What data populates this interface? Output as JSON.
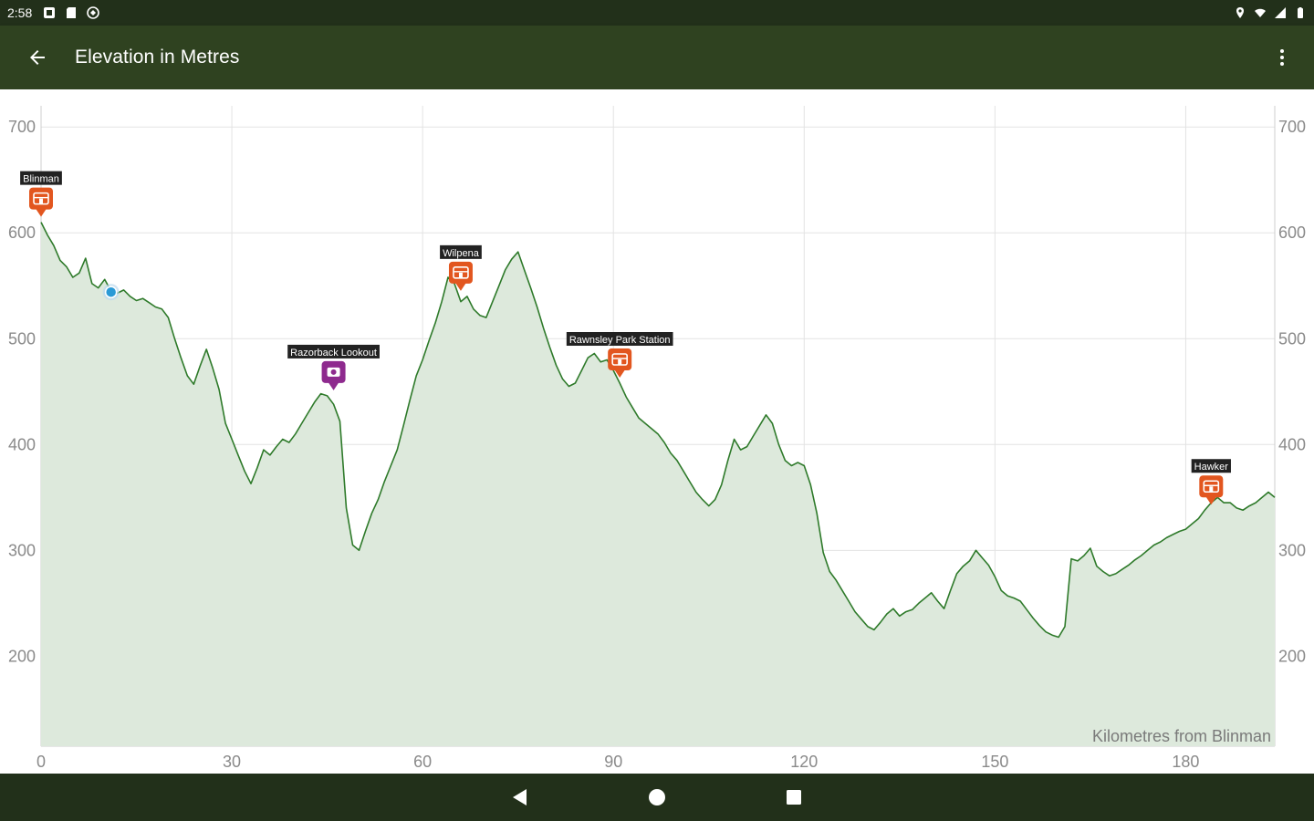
{
  "status_bar": {
    "time": "2:58",
    "left_icons": [
      "notification-icon",
      "sd-card-icon",
      "sync-icon"
    ],
    "right_icons": [
      "location-icon",
      "wifi-icon",
      "signal-icon",
      "battery-icon"
    ]
  },
  "app_bar": {
    "title": "Elevation in Metres",
    "back_icon": "arrow-back-icon",
    "menu_icon": "more-vert-icon"
  },
  "nav_bar": {
    "icons": [
      "nav-back-icon",
      "nav-home-icon",
      "nav-recents-icon"
    ]
  },
  "colors": {
    "status_bar": "#22301a",
    "app_bar": "#2f4220",
    "line": "#2e7a2a",
    "fill": "#dde9dc",
    "accommodation_marker": "#e2561f",
    "lookout_marker": "#8e2a8e",
    "current_position": "#2a9ad6",
    "grid": "#e3e3e3"
  },
  "chart_data": {
    "type": "area",
    "title": "",
    "xlabel": "Kilometres from Blinman",
    "ylabel": "",
    "xlim": [
      0,
      194
    ],
    "ylim": [
      115,
      720
    ],
    "xticks": [
      0,
      30,
      60,
      90,
      120,
      150,
      180
    ],
    "yticks": [
      200,
      300,
      400,
      500,
      600,
      700
    ],
    "grid": true,
    "y_axis_sides": [
      "left",
      "right"
    ],
    "series": [
      {
        "x": [
          0,
          1,
          2,
          3,
          4,
          5,
          6,
          7,
          8,
          9,
          10,
          11,
          12,
          13,
          14,
          15,
          16,
          17,
          18,
          19,
          20,
          21,
          22,
          23,
          24,
          25,
          26,
          27,
          28,
          29,
          30,
          31,
          32,
          33,
          34,
          35,
          36,
          37,
          38,
          39,
          40,
          41,
          42,
          43,
          44,
          45,
          46,
          47,
          48,
          49,
          50,
          51,
          52,
          53,
          54,
          55,
          56,
          57,
          58,
          59,
          60,
          61,
          62,
          63,
          64,
          65,
          66,
          67,
          68,
          69,
          70,
          71,
          72,
          73,
          74,
          75,
          76,
          77,
          78,
          79,
          80,
          81,
          82,
          83,
          84,
          85,
          86,
          87,
          88,
          89,
          90,
          91,
          92,
          93,
          94,
          95,
          96,
          97,
          98,
          99,
          100,
          101,
          102,
          103,
          104,
          105,
          106,
          107,
          108,
          109,
          110,
          111,
          112,
          113,
          114,
          115,
          116,
          117,
          118,
          119,
          120,
          121,
          122,
          123,
          124,
          125,
          126,
          127,
          128,
          129,
          130,
          131,
          132,
          133,
          134,
          135,
          136,
          137,
          138,
          139,
          140,
          141,
          142,
          143,
          144,
          145,
          146,
          147,
          148,
          149,
          150,
          151,
          152,
          153,
          154,
          155,
          156,
          157,
          158,
          159,
          160,
          161,
          162,
          163,
          164,
          165,
          166,
          167,
          168,
          169,
          170,
          171,
          172,
          173,
          174,
          175,
          176,
          177,
          178,
          179,
          180,
          181,
          182,
          183,
          184,
          185,
          186,
          187,
          188,
          189,
          190,
          191,
          192,
          193,
          194
        ],
        "y": [
          610,
          598,
          588,
          574,
          568,
          558,
          562,
          576,
          552,
          548,
          556,
          545,
          543,
          546,
          540,
          536,
          538,
          534,
          530,
          528,
          520,
          500,
          482,
          465,
          457,
          474,
          490,
          472,
          452,
          420,
          405,
          390,
          375,
          363,
          378,
          395,
          390,
          398,
          405,
          402,
          410,
          420,
          430,
          440,
          448,
          446,
          438,
          422,
          340,
          305,
          300,
          318,
          335,
          348,
          365,
          380,
          395,
          418,
          442,
          465,
          480,
          498,
          515,
          535,
          558,
          552,
          535,
          540,
          528,
          522,
          520,
          535,
          550,
          565,
          575,
          582,
          565,
          548,
          530,
          510,
          492,
          475,
          462,
          455,
          458,
          470,
          482,
          486,
          478,
          480,
          470,
          458,
          445,
          435,
          425,
          420,
          415,
          410,
          402,
          392,
          385,
          375,
          365,
          355,
          348,
          342,
          348,
          362,
          385,
          405,
          395,
          398,
          408,
          418,
          428,
          420,
          400,
          385,
          380,
          383,
          380,
          362,
          335,
          298,
          280,
          272,
          262,
          252,
          242,
          235,
          228,
          225,
          232,
          240,
          245,
          238,
          242,
          244,
          250,
          255,
          260,
          252,
          245,
          262,
          278,
          285,
          290,
          300,
          293,
          286,
          275,
          262,
          257,
          255,
          252,
          244,
          236,
          229,
          223,
          220,
          218,
          228,
          292,
          290,
          295,
          302,
          285,
          280,
          276,
          278,
          282,
          286,
          291,
          295,
          300,
          305,
          308,
          312,
          315,
          318,
          320,
          325,
          330,
          338,
          345,
          350,
          345,
          345,
          340,
          338,
          342,
          345,
          350,
          355,
          350
        ]
      }
    ],
    "markers": [
      {
        "label": "Blinman",
        "x": 0,
        "y": 610,
        "kind": "accommodation"
      },
      {
        "label": "Razorback Lookout",
        "x": 46,
        "y": 446,
        "kind": "lookout"
      },
      {
        "label": "Wilpena",
        "x": 66,
        "y": 540,
        "kind": "accommodation"
      },
      {
        "label": "Rawnsley Park Station",
        "x": 91,
        "y": 458,
        "kind": "accommodation"
      },
      {
        "label": "Hawker",
        "x": 184,
        "y": 338,
        "kind": "accommodation"
      }
    ],
    "current_position": {
      "x": 11,
      "y": 544
    }
  }
}
